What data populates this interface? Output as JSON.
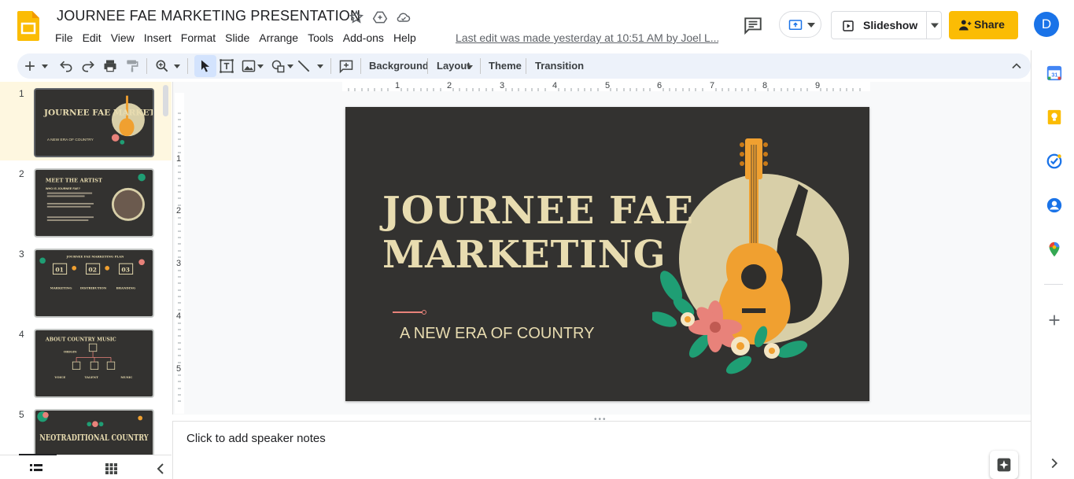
{
  "header": {
    "title": "JOURNEE FAE MARKETING PRESENTATION",
    "menu": [
      "File",
      "Edit",
      "View",
      "Insert",
      "Format",
      "Slide",
      "Arrange",
      "Tools",
      "Add-ons",
      "Help"
    ],
    "last_edit": "Last edit was made yesterday at 10:51 AM by Joel L...",
    "slideshow_label": "Slideshow",
    "share_label": "Share",
    "avatar_letter": "D"
  },
  "toolbar": {
    "background_label": "Background",
    "layout_label": "Layout",
    "theme_label": "Theme",
    "transition_label": "Transition"
  },
  "filmstrip": {
    "slides": [
      {
        "number": "1",
        "title": "JOURNEE FAE MARKETING",
        "subtitle": "A NEW ERA OF COUNTRY"
      },
      {
        "number": "2",
        "title": "MEET THE ARTIST",
        "subtitle": "WHO IS JOURNEE FAE?"
      },
      {
        "number": "3",
        "title": "JOURNEE FAE MARKETING PLAN",
        "items": [
          "01",
          "02",
          "03"
        ],
        "labels": [
          "MARKETING",
          "DISTRIBUTION",
          "BRANDING"
        ]
      },
      {
        "number": "4",
        "title": "ABOUT COUNTRY MUSIC",
        "labels": [
          "ORIGIN",
          "VOICE",
          "TALENT",
          "MUSIC"
        ]
      },
      {
        "number": "5",
        "title": "NEOTRADITIONAL COUNTRY"
      }
    ]
  },
  "ruler": {
    "h_labels": [
      "1",
      "2",
      "3",
      "4",
      "5",
      "6",
      "7",
      "8",
      "9"
    ],
    "v_labels": [
      "1",
      "2",
      "3",
      "4",
      "5"
    ]
  },
  "slide": {
    "title_line1": "JOURNEE FAE",
    "title_line2": "MARKETING",
    "subtitle": "A NEW ERA OF COUNTRY"
  },
  "notes": {
    "placeholder": "Click to add speaker notes"
  },
  "colors": {
    "slide_bg": "#333230",
    "cream": "#e8dcb0",
    "accent_orange": "#f0a030",
    "accent_coral": "#e8827a",
    "leaf_green": "#1f9e74",
    "share_yellow": "#fbbc04"
  }
}
